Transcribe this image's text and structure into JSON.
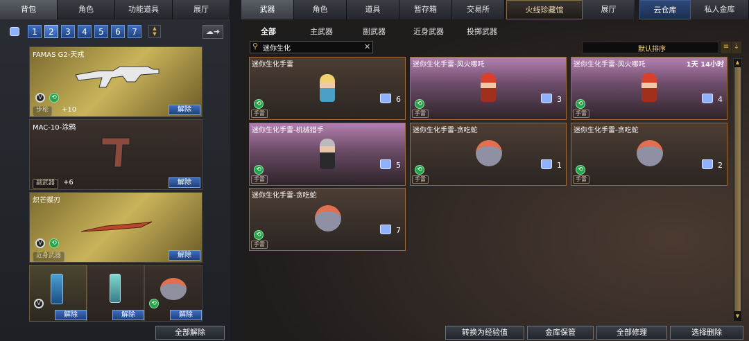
{
  "left_tabs": [
    "背包",
    "角色",
    "功能道具",
    "展厅"
  ],
  "bag_numbers": [
    "1",
    "2",
    "3",
    "4",
    "5",
    "6",
    "7"
  ],
  "weapons": [
    {
      "name": "FAMAS G2-天戎",
      "type": "步枪",
      "bonus": "+10",
      "unlock": "解除"
    },
    {
      "name": "MAC-10-涂鸦",
      "type": "副武器",
      "bonus": "+6",
      "unlock": "解除"
    },
    {
      "name": "炽芒蝶刃",
      "type": "近身武器",
      "unlock": "解除"
    }
  ],
  "small_slots": [
    {
      "unlock": "解除"
    },
    {
      "unlock": "解除"
    },
    {
      "unlock": "解除"
    }
  ],
  "unlock_all": "全部解除",
  "right_tabs": [
    "武器",
    "角色",
    "道具",
    "暂存箱",
    "交易所",
    "火线珍藏馆",
    "展厅"
  ],
  "storage_tabs": [
    "云仓库",
    "私人金库"
  ],
  "sub_tabs": [
    "全部",
    "主武器",
    "副武器",
    "近身武器",
    "投掷武器"
  ],
  "search": {
    "value": "迷你生化"
  },
  "sort_label": "默认排序",
  "items": [
    {
      "title": "迷你生化手雷",
      "tag": "手雷",
      "count": "6"
    },
    {
      "title": "迷你生化手雷-风火哪吒",
      "tag": "手雷",
      "count": "3"
    },
    {
      "title": "迷你生化手雷-风火哪吒",
      "tag": "手雷",
      "count": "4",
      "timer": "1天 14小时"
    },
    {
      "title": "迷你生化手雷-机械猎手",
      "tag": "手雷",
      "count": "5"
    },
    {
      "title": "迷你生化手雷-贪吃蛇",
      "tag": "手雷",
      "count": "1"
    },
    {
      "title": "迷你生化手雷-贪吃蛇",
      "tag": "手雷",
      "count": "2"
    },
    {
      "title": "迷你生化手雷-贪吃蛇",
      "tag": "手雷",
      "count": "7"
    }
  ],
  "bottom_buttons": [
    "转换为经验值",
    "金库保管",
    "全部修理",
    "选择删除"
  ]
}
